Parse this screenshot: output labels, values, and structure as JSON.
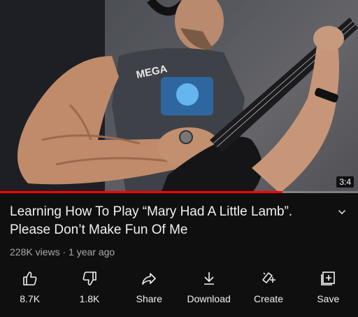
{
  "video": {
    "duration": "3:4",
    "progress_fraction": 0.79,
    "shirt_text": "MEGA"
  },
  "title": "Learning How To Play “Mary Had A Little Lamb”. Please Don’t Make Fun Of Me",
  "meta": "228K views · 1 year ago",
  "actions": [
    {
      "id": "like",
      "label": "8.7K",
      "icon": "thumbs-up-icon"
    },
    {
      "id": "dislike",
      "label": "1.8K",
      "icon": "thumbs-down-icon"
    },
    {
      "id": "share",
      "label": "Share",
      "icon": "share-icon"
    },
    {
      "id": "download",
      "label": "Download",
      "icon": "download-icon"
    },
    {
      "id": "create",
      "label": "Create",
      "icon": "create-icon"
    },
    {
      "id": "save",
      "label": "Save",
      "icon": "save-playlist-icon"
    }
  ],
  "colors": {
    "background": "#0f0f0f",
    "progress": "#ff0000",
    "meta_text": "#aaaaaa"
  }
}
